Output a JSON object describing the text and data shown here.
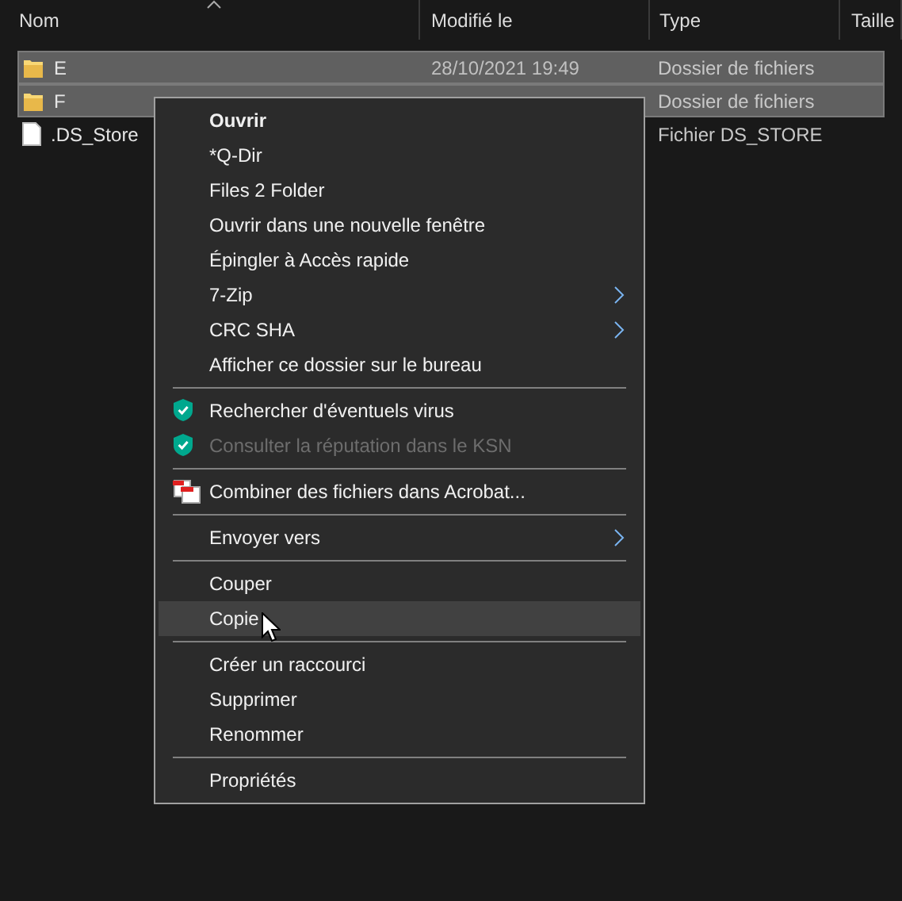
{
  "columns": [
    {
      "label": "Nom"
    },
    {
      "label": "Modifié le"
    },
    {
      "label": "Type"
    },
    {
      "label": "Taille"
    }
  ],
  "rows": [
    {
      "name": "E",
      "date": "28/10/2021 19:49",
      "type": "Dossier de fichiers",
      "kind": "folder",
      "selected": true
    },
    {
      "name": "F",
      "type": "Dossier de fichiers",
      "kind": "folder",
      "selected": true
    },
    {
      "name": ".DS_Store",
      "type": "Fichier DS_STORE",
      "kind": "file",
      "selected": false
    }
  ],
  "context_menu": {
    "items": [
      {
        "kind": "plain",
        "label": "Ouvrir",
        "bold": true,
        "disabled": false,
        "submenu": false,
        "selected": false
      },
      {
        "kind": "plain",
        "label": "*Q-Dir",
        "bold": false,
        "disabled": false,
        "submenu": false,
        "selected": false
      },
      {
        "kind": "plain",
        "label": "Files 2 Folder",
        "bold": false,
        "disabled": false,
        "submenu": false,
        "selected": false
      },
      {
        "kind": "plain",
        "label": "Ouvrir dans une nouvelle fenêtre",
        "bold": false,
        "disabled": false,
        "submenu": false,
        "selected": false
      },
      {
        "kind": "plain",
        "label": "Épingler à Accès rapide",
        "bold": false,
        "disabled": false,
        "submenu": false,
        "selected": false
      },
      {
        "kind": "plain",
        "label": "7-Zip",
        "bold": false,
        "disabled": false,
        "submenu": true,
        "selected": false
      },
      {
        "kind": "plain",
        "label": "CRC SHA",
        "bold": false,
        "disabled": false,
        "submenu": true,
        "selected": false
      },
      {
        "kind": "plain",
        "label": "Afficher ce dossier sur le bureau",
        "bold": false,
        "disabled": false,
        "submenu": false,
        "selected": false
      },
      {
        "kind": "separator"
      },
      {
        "kind": "shield",
        "label": "Rechercher d'éventuels virus",
        "bold": false,
        "disabled": false,
        "submenu": false,
        "selected": false
      },
      {
        "kind": "shield",
        "label": "Consulter la réputation dans le KSN",
        "bold": false,
        "disabled": true,
        "submenu": false,
        "selected": false
      },
      {
        "kind": "separator"
      },
      {
        "kind": "documents",
        "label": "Combiner des fichiers dans Acrobat...",
        "bold": false,
        "disabled": false,
        "submenu": false,
        "selected": false
      },
      {
        "kind": "separator"
      },
      {
        "kind": "plain",
        "label": "Envoyer vers",
        "bold": false,
        "disabled": false,
        "submenu": true,
        "selected": false
      },
      {
        "kind": "separator"
      },
      {
        "kind": "plain",
        "label": "Couper",
        "bold": false,
        "disabled": false,
        "submenu": false,
        "selected": false
      },
      {
        "kind": "plain",
        "label": "Copie",
        "bold": false,
        "disabled": false,
        "submenu": false,
        "selected": true
      },
      {
        "kind": "separator"
      },
      {
        "kind": "plain",
        "label": "Créer un raccourci",
        "bold": false,
        "disabled": false,
        "submenu": false,
        "selected": false
      },
      {
        "kind": "plain",
        "label": "Supprimer",
        "bold": false,
        "disabled": false,
        "submenu": false,
        "selected": false
      },
      {
        "kind": "plain",
        "label": "Renommer",
        "bold": false,
        "disabled": false,
        "submenu": false,
        "selected": false
      },
      {
        "kind": "separator"
      },
      {
        "kind": "plain",
        "label": "Propriétés",
        "bold": false,
        "disabled": false,
        "submenu": false,
        "selected": false
      }
    ]
  }
}
